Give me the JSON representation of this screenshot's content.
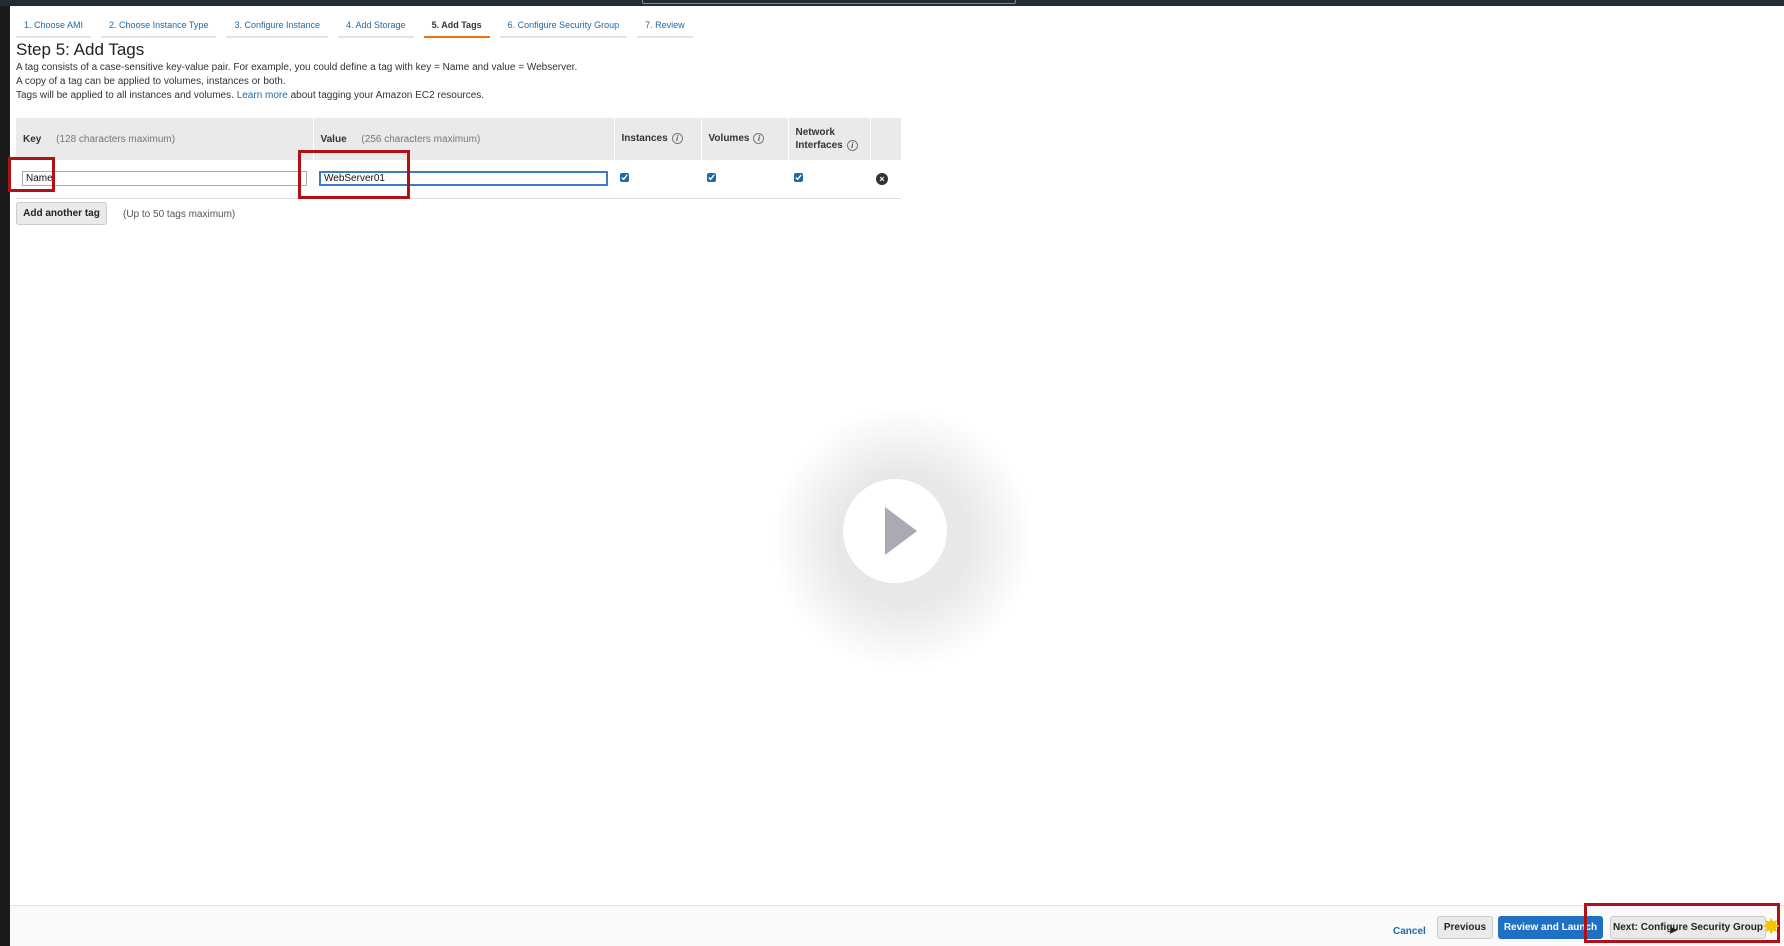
{
  "wizard_tabs": [
    {
      "label": "1. Choose AMI"
    },
    {
      "label": "2. Choose Instance Type"
    },
    {
      "label": "3. Configure Instance"
    },
    {
      "label": "4. Add Storage"
    },
    {
      "label": "5. Add Tags",
      "active": true
    },
    {
      "label": "6. Configure Security Group"
    },
    {
      "label": "7. Review"
    }
  ],
  "page": {
    "title": "Step 5: Add Tags",
    "desc1": "A tag consists of a case-sensitive key-value pair. For example, you could define a tag with key = Name and value = Webserver.",
    "desc2": "A copy of a tag can be applied to volumes, instances or both.",
    "desc3_pre": "Tags will be applied to all instances and volumes.",
    "desc3_link": "Learn more",
    "desc3_post": "about tagging your Amazon EC2 resources."
  },
  "table": {
    "col_key": "Key",
    "col_key_hint": "(128 characters maximum)",
    "col_value": "Value",
    "col_value_hint": "(256 characters maximum)",
    "col_instances": "Instances",
    "col_volumes": "Volumes",
    "col_network_1": "Network",
    "col_network_2": "Interfaces",
    "rows": [
      {
        "key": "Name",
        "value": "WebServer01",
        "instances": true,
        "volumes": true,
        "network_interfaces": true
      }
    ]
  },
  "add_tag": {
    "button": "Add another tag",
    "hint": "(Up to 50 tags maximum)"
  },
  "footer": {
    "cancel": "Cancel",
    "previous": "Previous",
    "review_launch": "Review and Launch",
    "next": "Next: Configure Security Group"
  },
  "icons": {
    "info": "info-icon",
    "remove": "remove-tag-icon",
    "play": "play-icon",
    "cursor": "mouse-pointer-icon"
  },
  "colors": {
    "accent": "#ec7211",
    "link": "#1f6aa5",
    "primary_button": "#1f6fc5",
    "highlight": "#b11016"
  }
}
